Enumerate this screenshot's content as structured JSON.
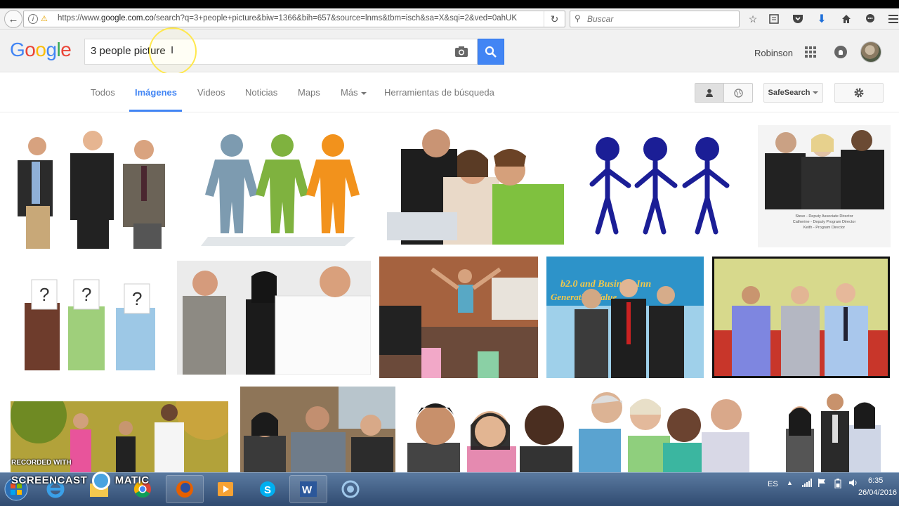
{
  "browser": {
    "url": "https://www.google.com.co/search?q=3+people+picture&biw=1366&bih=657&source=lnms&tbm=isch&sa=X&sqi=2&ved=0ahUK",
    "search_placeholder": "Buscar"
  },
  "google": {
    "logo_text": "Google",
    "query": "3 people picture",
    "user_name": "Robinson"
  },
  "tabs": {
    "items": [
      "Todos",
      "Imágenes",
      "Videos",
      "Noticias",
      "Maps",
      "Más",
      "Herramientas de búsqueda"
    ],
    "active": "Imágenes",
    "safesearch_label": "SafeSearch"
  },
  "results": {
    "thumb3_caption": [
      "Steve - Deputy Associate Director",
      "Catherine - Deputy Program Director",
      "Keith - Program Director"
    ],
    "thumb_conference_banner": "b2.0 and Business Inn",
    "thumb_conference_banner2": "Generating Value"
  },
  "taskbar": {
    "lang": "ES",
    "time": "6:35",
    "date": "26/04/2016"
  },
  "watermark": {
    "line1": "RECORDED WITH",
    "line2": "SCREENCAST",
    "line3": "MATIC"
  },
  "colors": {
    "google_blue": "#4285f4",
    "tab_active": "#4285f4"
  }
}
